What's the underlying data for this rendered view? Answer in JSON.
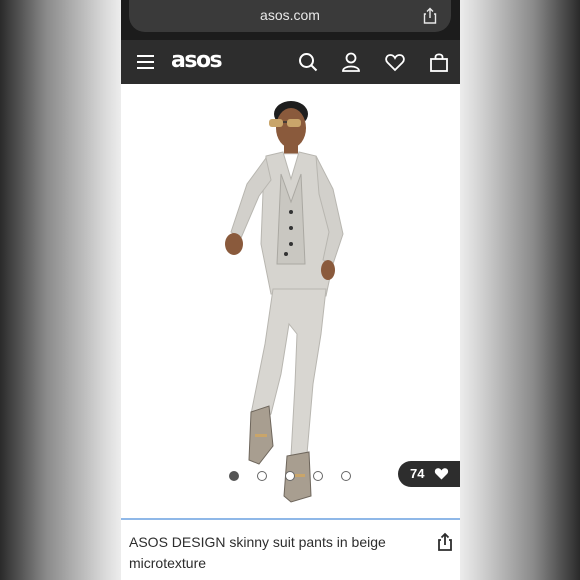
{
  "browser": {
    "url": "asos.com"
  },
  "header": {
    "logo": "asos"
  },
  "product": {
    "title": "ASOS DESIGN skinny suit pants in beige microtexture",
    "likes": "74",
    "image_count": 5,
    "active_image": 1
  },
  "icons": [
    "share-icon",
    "menu-icon",
    "search-icon",
    "account-icon",
    "heart-icon",
    "bag-icon"
  ],
  "colors": {
    "navbar": "#2d2d2d",
    "suit": "#d4d2cd",
    "accent": "#8fb8e8"
  }
}
